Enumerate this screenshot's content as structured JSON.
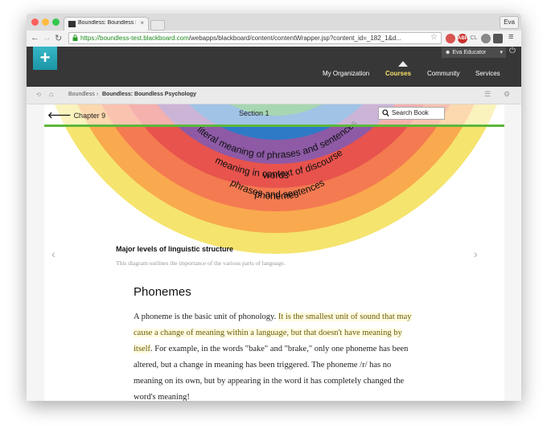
{
  "browser": {
    "tab_title": "Boundless: Boundless Psy",
    "tab_close": "×",
    "profile": "Eva",
    "url_host": "https://boundless-test.blackboard.com",
    "url_path": "/webapps/blackboard/content/contentWrapper.jsp?content_id=_182_1&d...",
    "ext_label": "CL",
    "light_colors": [
      "#fc605c",
      "#fdbc40",
      "#34c84a"
    ]
  },
  "header": {
    "logo_glyph": "+",
    "user_name": "Eva Educator",
    "nav": [
      {
        "label": "My Organization",
        "active": false
      },
      {
        "label": "Courses",
        "active": true
      },
      {
        "label": "Community",
        "active": false
      },
      {
        "label": "Services",
        "active": false
      }
    ]
  },
  "breadcrumb": {
    "root": "Boundless",
    "separator": "›",
    "current": "Boundless: Boundless Psychology"
  },
  "book": {
    "chapter_label": "Chapter 9",
    "section_label": "Section 1",
    "search_label": "Search Book",
    "accent_color": "#5cb83a"
  },
  "diagram": {
    "ring_labels": [
      "phonemes",
      "words",
      "phrases and sentences",
      "literal meaning of phrases and sentences",
      "meaning in context of discourse"
    ],
    "ring_colors": [
      "#f5e46e",
      "#f9a94e",
      "#f47a51",
      "#e8534d",
      "#8e5aa6",
      "#2e7ac7",
      "#3ca654",
      "#a6d9a8"
    ],
    "caption_title": "Major levels of linguistic structure",
    "caption_text": "This diagram outlines the importance of the various parts of language."
  },
  "content": {
    "heading": "Phonemes",
    "p_start": "A phoneme is the basic unit of phonology. ",
    "p_highlight": "It is the smallest unit of sound that may cause a change of meaning within a language, but that doesn't have meaning by itself",
    "p_end": ". For example, in the words \"bake\" and \"brake,\" only one phoneme has been altered, but a change in meaning has been triggered. The phoneme /r/ has no meaning on its own, but by appearing in the word it has completely changed the word's meaning!"
  }
}
